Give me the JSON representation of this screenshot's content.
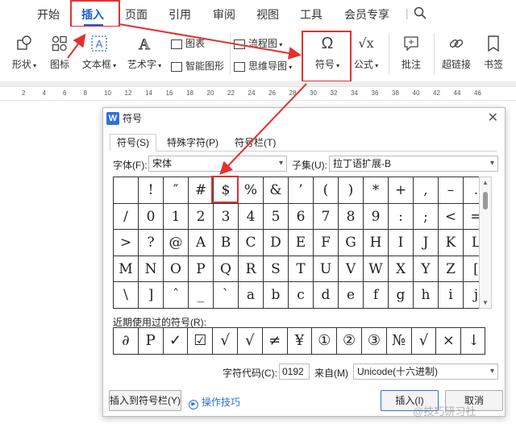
{
  "menubar": {
    "tabs": [
      "开始",
      "插入",
      "页面",
      "引用",
      "审阅",
      "视图",
      "工具",
      "会员专享"
    ],
    "active_tab": "插入",
    "search_icon": "search-icon"
  },
  "ribbon": {
    "shape": "形状",
    "icon": "图标",
    "textbox": "文本框",
    "wordart": "艺术字",
    "chart": "图表",
    "smartart": "智能图形",
    "flowchart": "流程图",
    "mindmap": "思维导图",
    "symbol": "符号",
    "formula": "公式",
    "comment": "批注",
    "hyperlink": "超链接",
    "bookmark": "书签"
  },
  "ruler": {
    "ticks": [
      "2",
      "4",
      "6",
      "8",
      "10",
      "12",
      "14",
      "16",
      "18",
      "20",
      "22",
      "24",
      "26",
      "28",
      "30",
      "32",
      "34",
      "36",
      "38",
      "40",
      "42",
      "44",
      "46"
    ]
  },
  "dialog": {
    "title": "符号",
    "tabs": [
      "符号(S)",
      "特殊字符(P)",
      "符号栏(T)"
    ],
    "font_label": "字体(F):",
    "font_value": "宋体",
    "subset_label": "子集(U):",
    "subset_value": "拉丁语扩展-B",
    "symbols": [
      "",
      "!",
      "″",
      "#",
      "$",
      "%",
      "&",
      "’",
      "(",
      ")",
      "*",
      "+",
      ",",
      "–",
      ".",
      "/",
      "0",
      "1",
      "2",
      "3",
      "4",
      "5",
      "6",
      "7",
      "8",
      "9",
      ":",
      ";",
      "<",
      "=",
      ">",
      "?",
      "@",
      "A",
      "B",
      "C",
      "D",
      "E",
      "F",
      "G",
      "H",
      "I",
      "J",
      "K",
      "L",
      "M",
      "N",
      "O",
      "P",
      "Q",
      "R",
      "S",
      "T",
      "U",
      "V",
      "W",
      "X",
      "Y",
      "Z",
      "[",
      "\\",
      "]",
      "ˆ",
      "_",
      "`",
      "a",
      "b",
      "c",
      "d",
      "e",
      "f",
      "g",
      "h",
      "i",
      "j"
    ],
    "recent_label": "近期使用过的符号(R):",
    "recent": [
      "∂",
      "P",
      "✓",
      "☑",
      "√",
      "√",
      "≠",
      "¥",
      "①",
      "②",
      "③",
      "№",
      "√",
      "×",
      "↓"
    ],
    "code_label": "字符代码(C):",
    "code_value": "0192",
    "from_label": "来自(M)",
    "from_value": "Unicode(十六进制)",
    "insert_to_bar": "插入到符号栏(Y)",
    "tips": "操作技巧",
    "insert": "插入(I)",
    "cancel": "取消"
  },
  "watermark": "@技巧研习社",
  "colors": {
    "accent": "#1f5ec9",
    "highlight": "#e53030"
  }
}
